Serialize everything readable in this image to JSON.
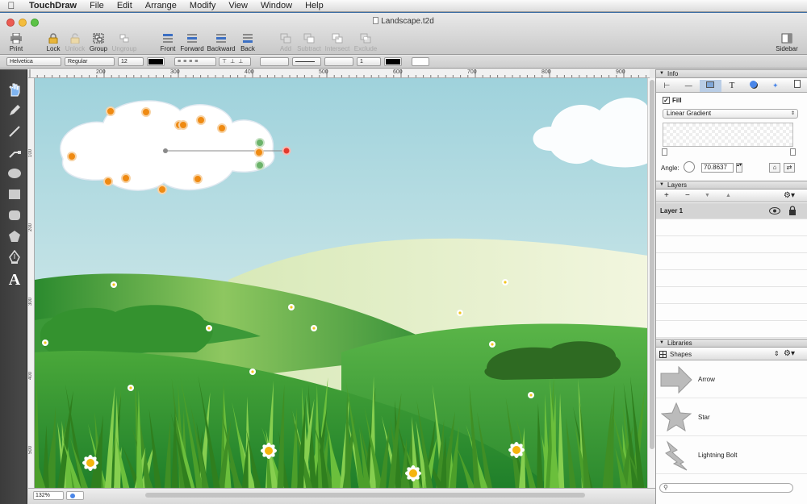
{
  "menubar": {
    "apple": "",
    "app_name": "TouchDraw",
    "items": [
      "File",
      "Edit",
      "Arrange",
      "Modify",
      "View",
      "Window",
      "Help"
    ]
  },
  "window": {
    "title": "Landscape.t2d"
  },
  "toolbar": {
    "print": "Print",
    "lock": "Lock",
    "unlock": "Unlock",
    "group": "Group",
    "ungroup": "Ungroup",
    "front": "Front",
    "forward": "Forward",
    "backward": "Backward",
    "back": "Back",
    "add": "Add",
    "subtract": "Subtract",
    "intersect": "Intersect",
    "exclude": "Exclude",
    "sidebar": "Sidebar"
  },
  "formatbar": {
    "font_family": "Helvetica",
    "font_style": "Regular",
    "font_size": "12",
    "line_width": "1",
    "text_color": "#000000"
  },
  "rulers": {
    "top": [
      "200",
      "300",
      "400",
      "500",
      "600",
      "700",
      "800",
      "900"
    ],
    "left": [
      "100",
      "200",
      "300",
      "400",
      "500"
    ]
  },
  "statusbar": {
    "zoom": "132%"
  },
  "info": {
    "header": "Info",
    "fill_label": "Fill",
    "fill_checked": true,
    "fill_type": "Linear Gradient",
    "angle_label": "Angle:",
    "angle_value": "70.8637"
  },
  "layers": {
    "header": "Layers",
    "items": [
      {
        "name": "Layer 1"
      }
    ]
  },
  "libraries": {
    "header": "Libraries",
    "selected": "Shapes",
    "items": [
      "Arrow",
      "Star",
      "Lightning Bolt"
    ]
  },
  "colors": {
    "sky_top": "#9fd2dc",
    "sky_bottom": "#e8f3ef",
    "grass_dark": "#1f7f2a",
    "grass_light": "#4aa83a",
    "handle_orange": "#ef8a12",
    "handle_red": "#e33a2e",
    "handle_green": "#6cb36a"
  }
}
